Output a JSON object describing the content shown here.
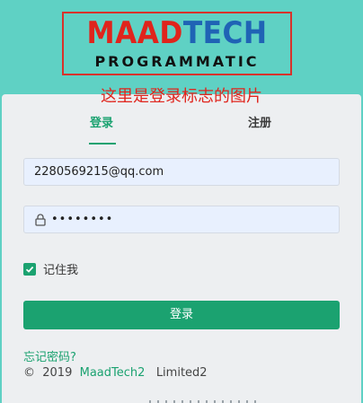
{
  "logo": {
    "word1": "MAAD",
    "word2": "TECH",
    "subtitle": "PROGRAMMATIC",
    "note": "这里是登录标志的图片",
    "colors": {
      "red": "#e0241c",
      "blue": "#1f63b5",
      "border": "#d8322b"
    }
  },
  "tabs": [
    {
      "label": "登录",
      "active": true
    },
    {
      "label": "注册",
      "active": false
    }
  ],
  "form": {
    "username_value": "2280569215@qq.com",
    "password_value": "••••••••",
    "remember_label": "记住我",
    "remember_checked": true,
    "submit_label": "登录",
    "forgot_label": "忘记密码?"
  },
  "footer": {
    "copyright": "©  2019  ",
    "company_link": "MaadTech2",
    "suffix": "   Limited2"
  },
  "colors": {
    "background": "#5fd1c4",
    "accent": "#1ba270",
    "card": "#edeff1",
    "input": "#e8f0fe"
  },
  "icons": [
    "lock-icon",
    "checkmark-icon"
  ]
}
